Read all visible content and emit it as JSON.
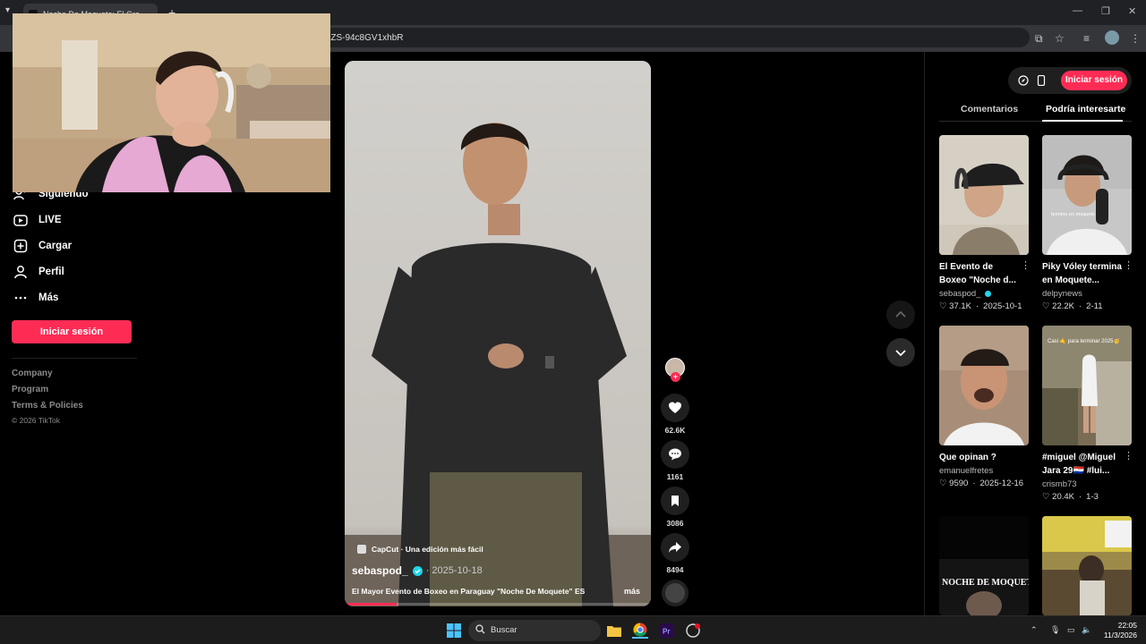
{
  "browser": {
    "tab_title": "Noche De Moquete: El Gra",
    "url_visible": "-ZS-94c8GV1xhbR",
    "new_tab": "+"
  },
  "left_nav": {
    "items": [
      {
        "label": "Siguiendo",
        "icon": "following-icon"
      },
      {
        "label": "LIVE",
        "icon": "live-icon"
      },
      {
        "label": "Cargar",
        "icon": "upload-icon"
      },
      {
        "label": "Perfil",
        "icon": "profile-icon"
      },
      {
        "label": "Más",
        "icon": "more-icon"
      }
    ],
    "login_button": "Iniciar sesión",
    "footer_links": [
      "Company",
      "Program",
      "Terms & Policies"
    ],
    "copyright": "© 2026 TikTok"
  },
  "video": {
    "capcut_label": "CapCut · Una edición más fácil",
    "author": "sebaspod_",
    "date": "· 2025-10-18",
    "description": "El Mayor Evento de Boxeo en Paraguay \"Noche De Moquete\" ES",
    "more_label": "más",
    "progress": 0.17
  },
  "actions": {
    "likes": "62.6K",
    "comments": "1161",
    "saves": "3086",
    "shares": "8494"
  },
  "right_panel": {
    "login_button": "Iniciar sesión",
    "tabs": [
      "Comentarios",
      "Podría interesarte"
    ],
    "active_tab": 1,
    "cards": [
      {
        "title": "El Evento de Boxeo \"Noche d...",
        "author": "sebaspod_",
        "verified": true,
        "likes": "37.1K",
        "date": "2025-10-1"
      },
      {
        "title": "Piky Vóley termina en Moquete...",
        "author": "delpynews",
        "verified": false,
        "likes": "22.2K",
        "date": "2-11",
        "thumb_caption": "termino en moquete"
      },
      {
        "title": "Que opinan ?",
        "author": "emanuelfretes",
        "verified": false,
        "likes": "9590",
        "date": "2025-12-16"
      },
      {
        "title": "#miguel @Miguel Jara 29🇵🇾 #lui...",
        "author": "crismb73",
        "verified": false,
        "likes": "20.4K",
        "date": "1-3",
        "thumb_caption": "Casi 🤙 para terminar 2025🥳"
      },
      {
        "thumb_caption": "NOCHE DE MOQUETE"
      }
    ]
  },
  "taskbar": {
    "search_placeholder": "Buscar",
    "time": "22:05",
    "date": "11/3/2026"
  },
  "colors": {
    "accent": "#fe2c55",
    "verified": "#20d5ec",
    "background": "#000000"
  }
}
